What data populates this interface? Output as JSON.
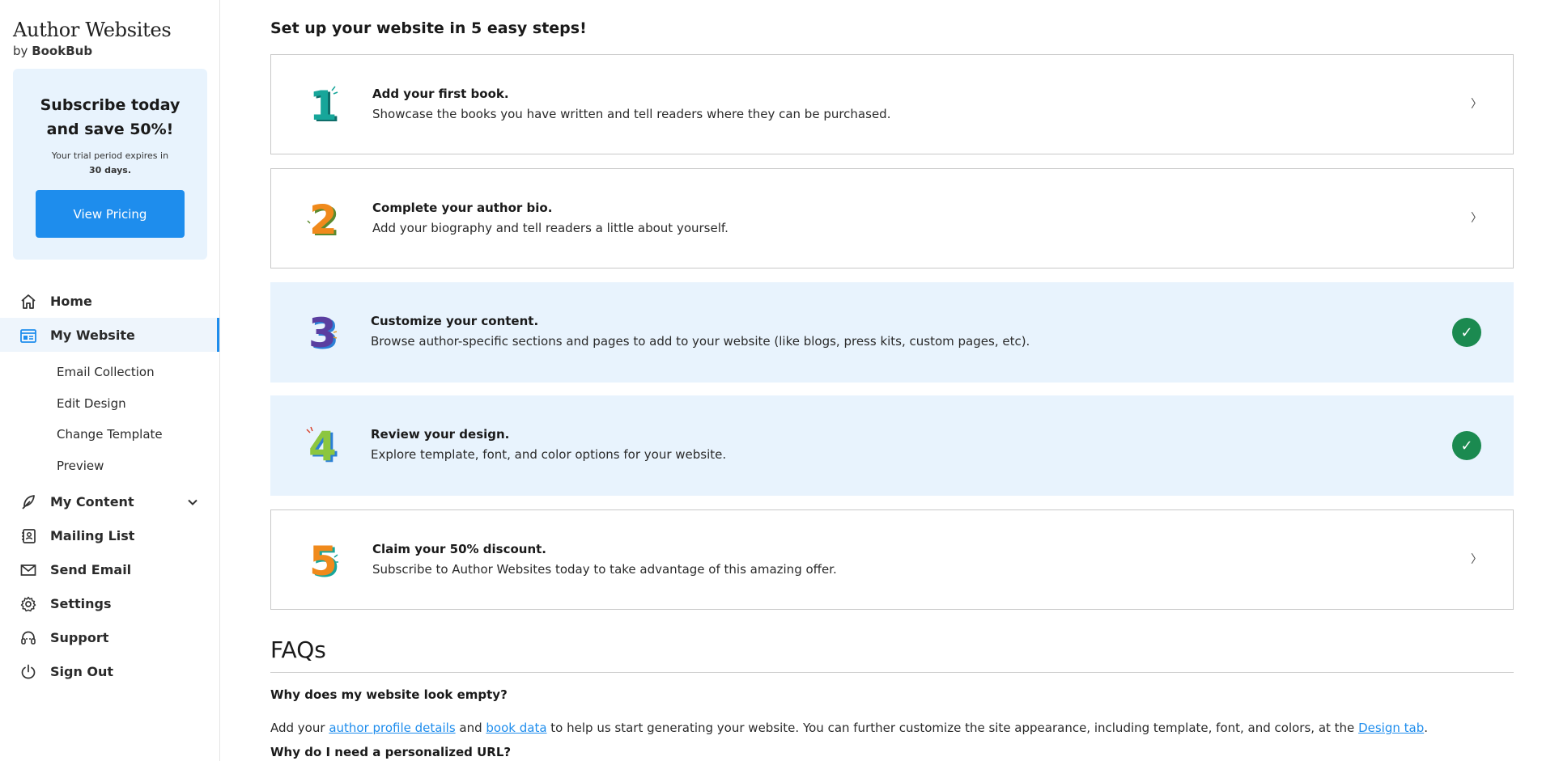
{
  "brand": {
    "title": "Author Websites",
    "by": "by",
    "name": "BookBub"
  },
  "promo": {
    "headline_line1": "Subscribe today",
    "headline_line2": "and save 50%!",
    "trial_text": "Your trial period expires in",
    "trial_days": "30 days.",
    "button_label": "View Pricing"
  },
  "nav": {
    "home": "Home",
    "my_website": "My Website",
    "sub": [
      "Email Collection",
      "Edit Design",
      "Change Template",
      "Preview"
    ],
    "my_content": "My Content",
    "mailing_list": "Mailing List",
    "send_email": "Send Email",
    "settings": "Settings",
    "support": "Support",
    "sign_out": "Sign Out"
  },
  "setup": {
    "title": "Set up your website in 5 easy steps!",
    "steps": [
      {
        "number": "1",
        "title": "Add your first book.",
        "desc": "Showcase the books you have written and tell readers where they can be purchased.",
        "completed": false,
        "arrow": "〉"
      },
      {
        "number": "2",
        "title": "Complete your author bio.",
        "desc": "Add your biography and tell readers a little about yourself.",
        "completed": false,
        "arrow": "〉"
      },
      {
        "number": "3",
        "title": "Customize your content.",
        "desc": "Browse author-specific sections and pages to add to your website (like blogs, press kits, custom pages, etc).",
        "completed": true,
        "check": "✓"
      },
      {
        "number": "4",
        "title": "Review your design.",
        "desc": "Explore template, font, and color options for your website.",
        "completed": true,
        "check": "✓"
      },
      {
        "number": "5",
        "title": "Claim your 50% discount.",
        "desc": "Subscribe to Author Websites today to take advantage of this amazing offer.",
        "completed": false,
        "arrow": "〉"
      }
    ]
  },
  "faq": {
    "title": "FAQs",
    "q1": "Why does my website look empty?",
    "a1_part1": "Add your ",
    "a1_link1": "author profile details",
    "a1_part2": " and ",
    "a1_link2": "book data",
    "a1_part3": " to help us start generating your website. You can further customize the site appearance, including template, font, and colors, at the ",
    "a1_link3": "Design tab",
    "a1_part4": ".",
    "q2": "Why do I need a personalized URL?"
  },
  "colors": {
    "accent": "#1e8ded",
    "done_bg": "#e8f3fd",
    "check_green": "#1b8a50"
  }
}
